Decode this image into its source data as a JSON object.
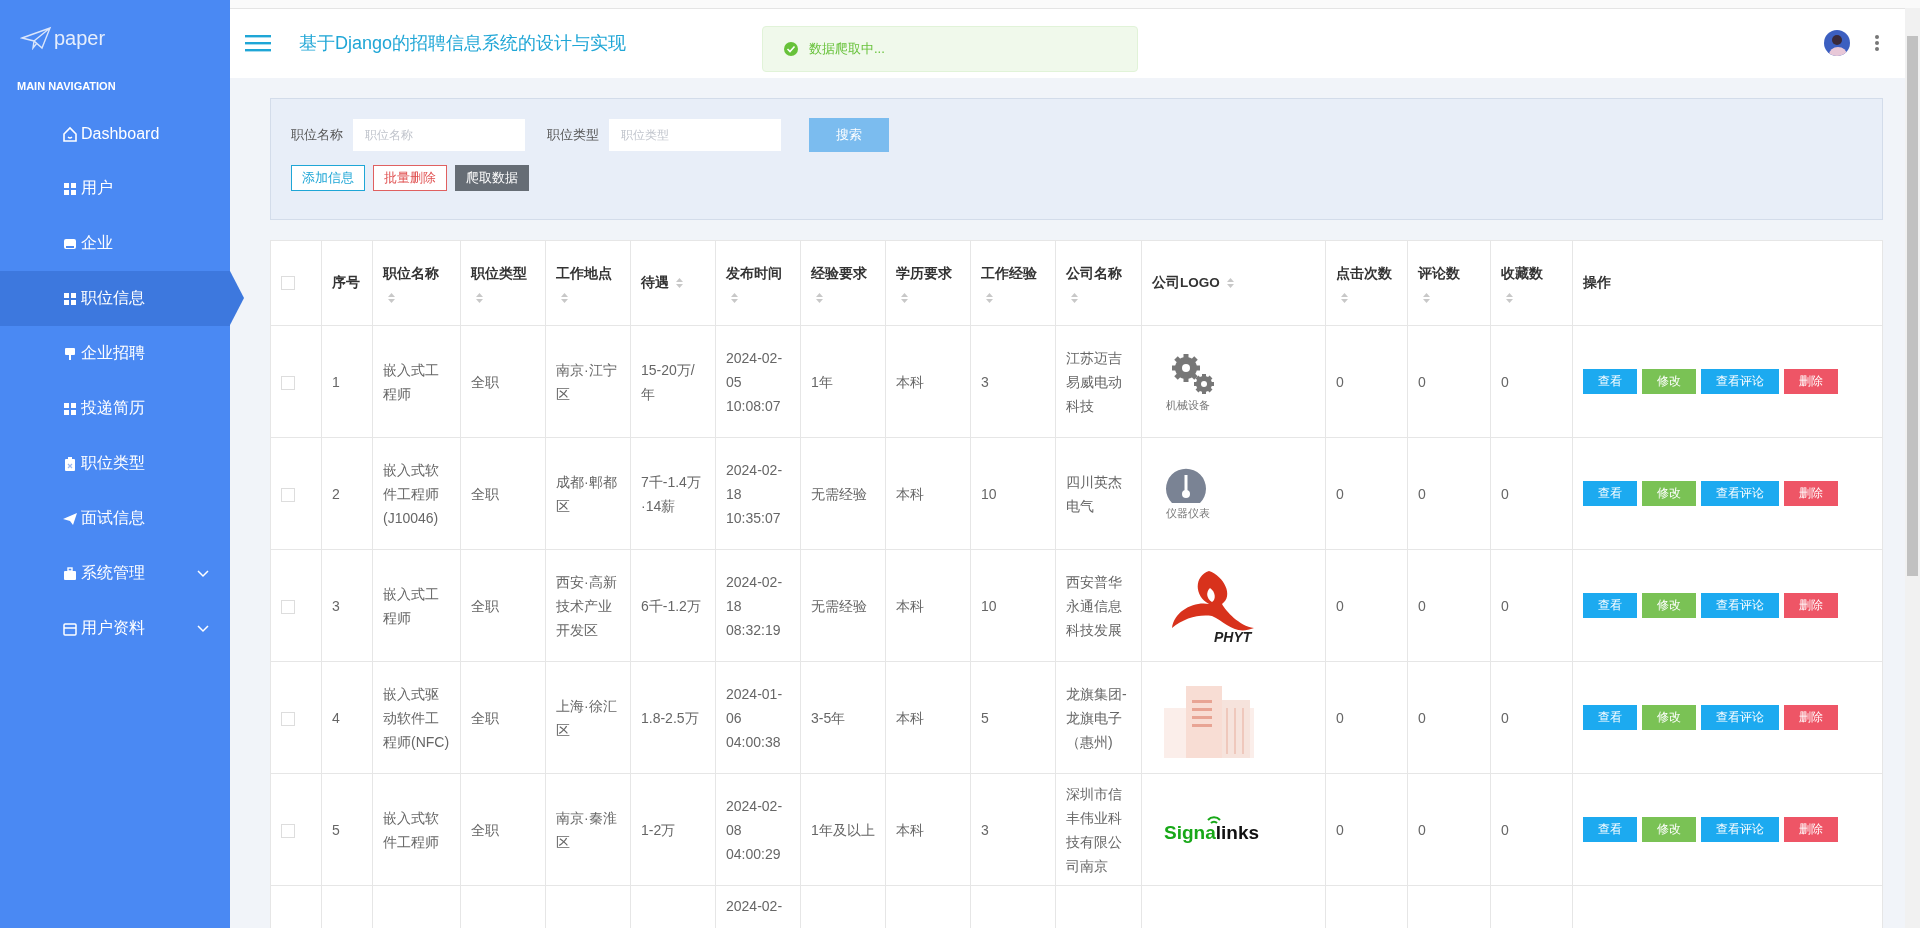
{
  "brand": "paper",
  "nav_heading": "MAIN NAVIGATION",
  "nav": [
    {
      "label": "Dashboard",
      "kind": "home",
      "selected": false,
      "expandable": false
    },
    {
      "label": "用户",
      "kind": "grid",
      "selected": false,
      "expandable": false
    },
    {
      "label": "企业",
      "kind": "box",
      "selected": false,
      "expandable": false
    },
    {
      "label": "职位信息",
      "kind": "grid",
      "selected": true,
      "expandable": false
    },
    {
      "label": "企业招聘",
      "kind": "pin",
      "selected": false,
      "expandable": false
    },
    {
      "label": "投递简历",
      "kind": "grid",
      "selected": false,
      "expandable": false
    },
    {
      "label": "职位类型",
      "kind": "clipboard",
      "selected": false,
      "expandable": false
    },
    {
      "label": "面试信息",
      "kind": "send",
      "selected": false,
      "expandable": false
    },
    {
      "label": "系统管理",
      "kind": "briefcase",
      "selected": false,
      "expandable": true
    },
    {
      "label": "用户资料",
      "kind": "window",
      "selected": false,
      "expandable": true
    }
  ],
  "header": {
    "title": "基于Django的招聘信息系统的设计与实现"
  },
  "toast": {
    "message": "数据爬取中..."
  },
  "search": {
    "fields": [
      {
        "label": "职位名称",
        "placeholder": "职位名称"
      },
      {
        "label": "职位类型",
        "placeholder": "职位类型"
      }
    ],
    "search_button": "搜索",
    "actions": [
      {
        "label": "添加信息",
        "kind": "outline-info"
      },
      {
        "label": "批量删除",
        "kind": "outline-danger"
      },
      {
        "label": "爬取数据",
        "kind": "dark"
      }
    ]
  },
  "table": {
    "all_checked": false,
    "columns": [
      {
        "label": "序号",
        "sortable": false
      },
      {
        "label": "职位名称",
        "sortable": true
      },
      {
        "label": "职位类型",
        "sortable": true
      },
      {
        "label": "工作地点",
        "sortable": true
      },
      {
        "label": "待遇",
        "sortable": true
      },
      {
        "label": "发布时间",
        "sortable": true
      },
      {
        "label": "经验要求",
        "sortable": true
      },
      {
        "label": "学历要求",
        "sortable": true
      },
      {
        "label": "工作经验",
        "sortable": true
      },
      {
        "label": "公司名称",
        "sortable": true
      },
      {
        "label": "公司LOGO",
        "sortable": true
      },
      {
        "label": "点击次数",
        "sortable": true
      },
      {
        "label": "评论数",
        "sortable": true
      },
      {
        "label": "收藏数",
        "sortable": true
      },
      {
        "label": "操作",
        "sortable": false
      }
    ],
    "rows": [
      {
        "checked": false,
        "cells": [
          "1",
          "嵌入式工程师",
          "全职",
          "南京·江宁区",
          "15-20万/年",
          "2024-02-05 10:08:07",
          "1年",
          "本科",
          "3",
          "江苏迈吉易威电动科技"
        ],
        "logo": {
          "kind": "gears",
          "caption": "机械设备"
        },
        "counts": [
          "0",
          "0",
          "0"
        ],
        "actions": [
          {
            "label": "查看",
            "kind": "view"
          },
          {
            "label": "修改",
            "kind": "edit"
          },
          {
            "label": "查看评论",
            "kind": "view"
          },
          {
            "label": "删除",
            "kind": "delete"
          }
        ]
      },
      {
        "checked": false,
        "cells": [
          "2",
          "嵌入式软件工程师(J10046)",
          "全职",
          "成都·郫都区",
          "7千-1.4万·14薪",
          "2024-02-18 10:35:07",
          "无需经验",
          "本科",
          "10",
          "四川英杰电气"
        ],
        "logo": {
          "kind": "gauge",
          "caption": "仪器仪表"
        },
        "counts": [
          "0",
          "0",
          "0"
        ],
        "actions": [
          {
            "label": "查看",
            "kind": "view"
          },
          {
            "label": "修改",
            "kind": "edit"
          },
          {
            "label": "查看评论",
            "kind": "view"
          },
          {
            "label": "删除",
            "kind": "delete"
          }
        ]
      },
      {
        "checked": false,
        "cells": [
          "3",
          "嵌入式工程师",
          "全职",
          "西安·高新技术产业开发区",
          "6千-1.2万",
          "2024-02-18 08:32:19",
          "无需经验",
          "本科",
          "10",
          "西安普华永通信息科技发展"
        ],
        "logo": {
          "kind": "swirl",
          "text": "PHYT"
        },
        "counts": [
          "0",
          "0",
          "0"
        ],
        "actions": [
          {
            "label": "查看",
            "kind": "view"
          },
          {
            "label": "修改",
            "kind": "edit"
          },
          {
            "label": "查看评论",
            "kind": "view"
          },
          {
            "label": "删除",
            "kind": "delete"
          }
        ]
      },
      {
        "checked": false,
        "cells": [
          "4",
          "嵌入式驱动软件工程师(NFC)",
          "全职",
          "上海·徐汇区",
          "1.8-2.5万",
          "2024-01-06 04:00:38",
          "3-5年",
          "本科",
          "5",
          "龙旗集团-龙旗电子（惠州)"
        ],
        "logo": {
          "kind": "picture"
        },
        "counts": [
          "0",
          "0",
          "0"
        ],
        "actions": [
          {
            "label": "查看",
            "kind": "view"
          },
          {
            "label": "修改",
            "kind": "edit"
          },
          {
            "label": "查看评论",
            "kind": "view"
          },
          {
            "label": "删除",
            "kind": "delete"
          }
        ]
      },
      {
        "checked": false,
        "cells": [
          "5",
          "嵌入式软件工程师",
          "全职",
          "南京·秦淮区",
          "1-2万",
          "2024-02-08 04:00:29",
          "1年及以上",
          "本科",
          "3",
          "深圳市信丰伟业科技有限公司南京"
        ],
        "logo": {
          "kind": "wordmark",
          "text": "Signalinks"
        },
        "counts": [
          "0",
          "0",
          "0"
        ],
        "actions": [
          {
            "label": "查看",
            "kind": "view"
          },
          {
            "label": "修改",
            "kind": "edit"
          },
          {
            "label": "查看评论",
            "kind": "view"
          },
          {
            "label": "删除",
            "kind": "delete"
          }
        ]
      },
      {
        "cells": [
          null,
          null,
          null,
          null,
          null,
          "2024-02-",
          null,
          null,
          null,
          null
        ]
      }
    ]
  }
}
